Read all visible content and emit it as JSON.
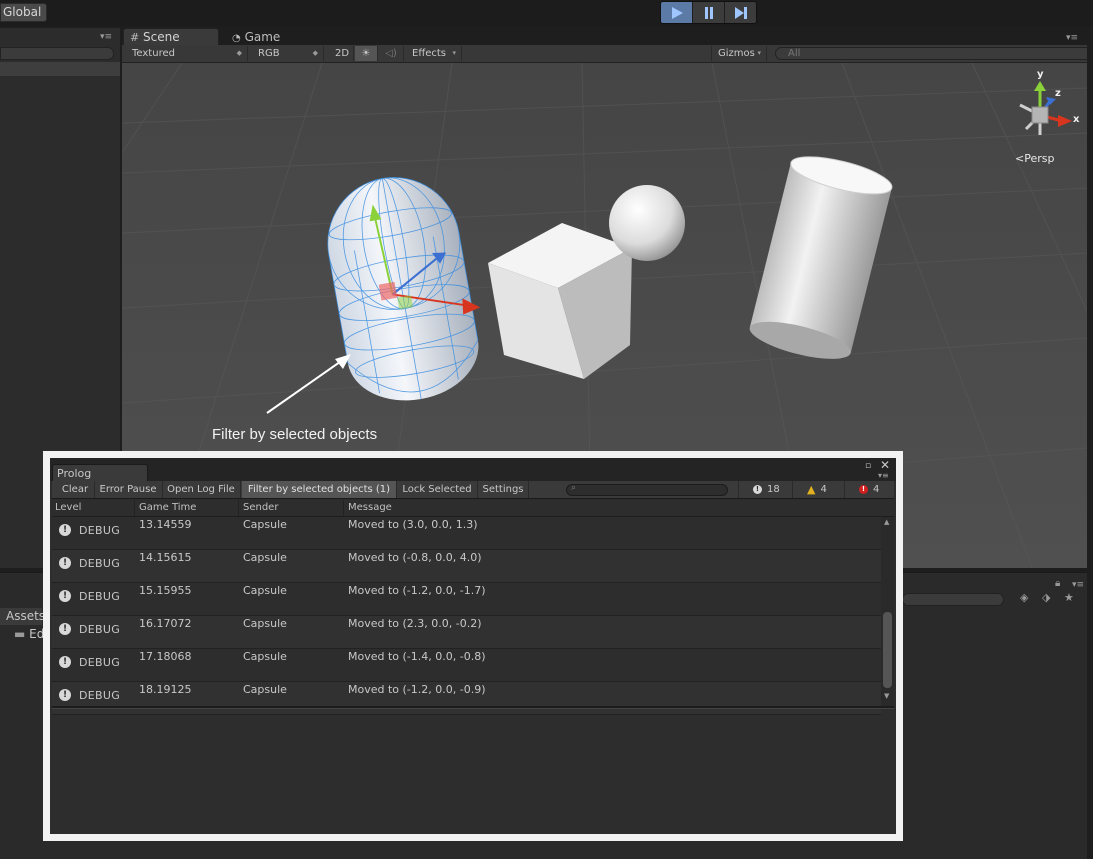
{
  "top": {
    "global_label": "Global"
  },
  "scene": {
    "tabs": [
      {
        "label": "Scene",
        "icon": "grid-icon"
      },
      {
        "label": "Game",
        "icon": "pacman-icon"
      }
    ],
    "toolbar": {
      "shading": "Textured",
      "render_mode": "RGB",
      "mode_2d": "2D",
      "effects": "Effects",
      "gizmos": "Gizmos",
      "search_placeholder": "All"
    },
    "gizmo": {
      "axis_y": "y",
      "axis_z": "z",
      "axis_x": "x",
      "projection": "Persp"
    }
  },
  "project": {
    "assets_tab": "Assets",
    "folder_label": "Ed"
  },
  "annotation": {
    "text": "Filter by selected objects"
  },
  "prolog": {
    "title": "Prolog",
    "toolbar": {
      "clear": "Clear",
      "error_pause": "Error Pause",
      "open_log_file": "Open Log File",
      "filter_selected": "Filter by selected objects (1)",
      "lock_selected": "Lock Selected",
      "settings": "Settings"
    },
    "counts": {
      "info": "18",
      "warnings": "4",
      "errors": "4"
    },
    "columns": {
      "level": "Level",
      "game_time": "Game Time",
      "sender": "Sender",
      "message": "Message"
    },
    "rows": [
      {
        "level": "DEBUG",
        "time": "13.14559",
        "sender": "Capsule",
        "message": "Moved to (3.0, 0.0, 1.3)"
      },
      {
        "level": "DEBUG",
        "time": "14.15615",
        "sender": "Capsule",
        "message": "Moved to (-0.8, 0.0, 4.0)"
      },
      {
        "level": "DEBUG",
        "time": "15.15955",
        "sender": "Capsule",
        "message": "Moved to (-1.2, 0.0, -1.7)"
      },
      {
        "level": "DEBUG",
        "time": "16.17072",
        "sender": "Capsule",
        "message": "Moved to (2.3, 0.0, -0.2)"
      },
      {
        "level": "DEBUG",
        "time": "17.18068",
        "sender": "Capsule",
        "message": "Moved to (-1.4, 0.0, -0.8)"
      },
      {
        "level": "DEBUG",
        "time": "18.19125",
        "sender": "Capsule",
        "message": "Moved to (-1.2, 0.0, -0.9)"
      }
    ]
  },
  "colors": {
    "play_active": "#5b7aa6",
    "warning": "#e0b020",
    "error": "#d02020",
    "gizmo_y": "#8bd13a",
    "gizmo_x": "#d8351f",
    "gizmo_z": "#3b6fd1"
  }
}
